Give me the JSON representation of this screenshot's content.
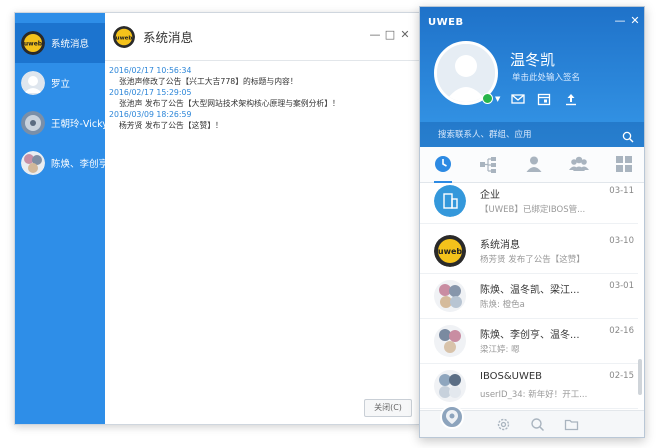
{
  "chat_window": {
    "conversations": [
      {
        "name": "系统消息",
        "avatar": "uweb-logo-avatar",
        "active": true
      },
      {
        "name": "罗立",
        "avatar": "default-avatar"
      },
      {
        "name": "王朝玲-Vicky",
        "avatar": "photo-avatar"
      },
      {
        "name": "陈焕、李创亨",
        "avatar": "group-avatar"
      }
    ],
    "header": {
      "title": "系统消息"
    },
    "window_buttons": {
      "minimize": "—",
      "maximize": "□",
      "close": "✕"
    },
    "messages": [
      {
        "time": "2016/02/17 10:56:34",
        "text": "张池声修改了公告【兴工大吉778】的标题与内容！"
      },
      {
        "time": "2016/02/17 15:29:05",
        "text": "张池声 发布了公告【大型网站技术架构核心原理与案例分析】！"
      },
      {
        "time": "2016/03/09 18:26:59",
        "text": "杨芳贤 发布了公告【这赞】！"
      }
    ],
    "close_label": "关闭(C)"
  },
  "panel": {
    "app_name": "UWEB",
    "window_buttons": {
      "minimize": "—",
      "close": "✕"
    },
    "user": {
      "name": "温冬凯",
      "signature": "单击此处输入签名",
      "status_color": "#27b54a"
    },
    "top_actions": [
      "mail-icon",
      "calendar-icon",
      "upload-icon"
    ],
    "search": {
      "placeholder": "搜索联系人、群组、应用"
    },
    "tabs": [
      "recent-icon",
      "org-tree-icon",
      "contacts-icon",
      "groups-icon",
      "apps-icon"
    ],
    "recent_list": [
      {
        "name": "企业",
        "time": "03-11",
        "last": "【UWEB】已绑定IBOS管...",
        "avatar": "enterprise-avatar"
      },
      {
        "name": "系统消息",
        "time": "03-10",
        "last": "杨芳贤 发布了公告【这赞】",
        "avatar": "uweb-logo-avatar"
      },
      {
        "name": "陈焕、温冬凯、梁江...",
        "time": "03-01",
        "last": "陈焕: 橙色a",
        "avatar": "group-avatar"
      },
      {
        "name": "陈焕、李创亨、温冬...",
        "time": "02-16",
        "last": "梁江婷: 嗯",
        "avatar": "group-avatar"
      },
      {
        "name": "IBOS&UWEB",
        "time": "02-15",
        "last": "userID_34: 新年好！开工...",
        "avatar": "group-avatar"
      }
    ],
    "bottom_bar": [
      "uweb-logo-icon",
      "settings-icon",
      "search-icon",
      "folder-icon"
    ]
  },
  "colors": {
    "accent_blue": "#2e8ee8",
    "sidebar_active": "#1c74cf",
    "timestamp_blue": "#2d86d8",
    "enterprise_icon": "#3498db"
  }
}
